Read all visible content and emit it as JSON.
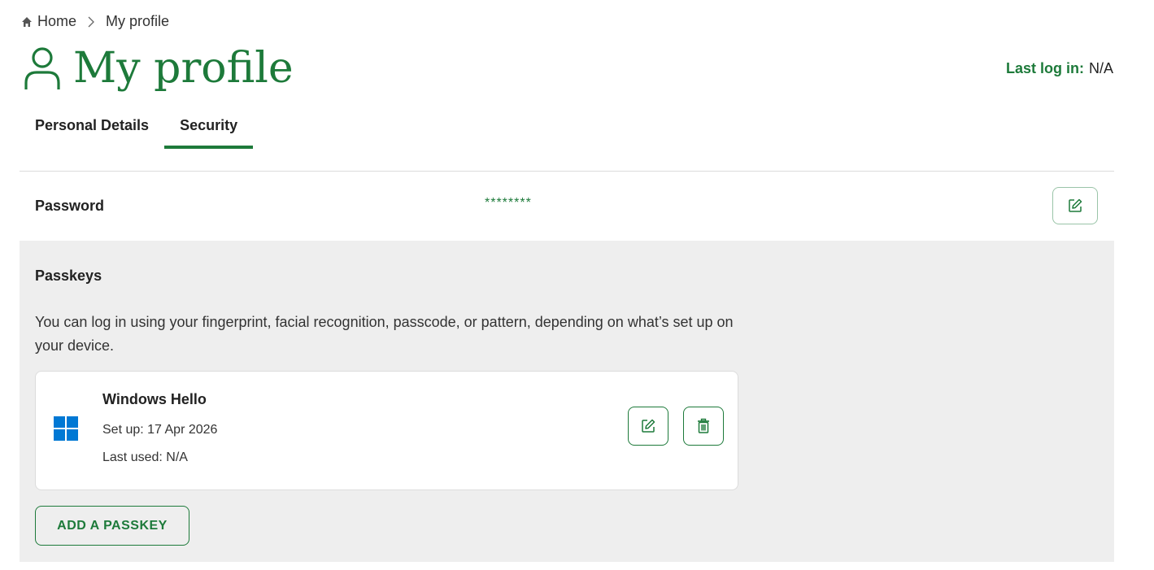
{
  "breadcrumb": {
    "home_label": "Home",
    "current_label": "My profile",
    "home_icon": "home-icon",
    "separator_icon": "chevron-right-icon"
  },
  "header": {
    "title": "My profile",
    "icon": "user-icon",
    "last_login_label": "Last log in:",
    "last_login_value": "N/A"
  },
  "tabs": [
    {
      "label": "Personal Details",
      "active": false
    },
    {
      "label": "Security",
      "active": true
    }
  ],
  "password": {
    "label": "Password",
    "value": "********",
    "edit_icon": "edit-icon"
  },
  "passkeys": {
    "title": "Passkeys",
    "description": "You can log in using your fingerprint, facial recognition, passcode, or pattern, depending on what’s set up on your device.",
    "items": [
      {
        "name": "Windows Hello",
        "icon": "windows-icon",
        "setup": "Set up: 17 Apr 2026",
        "last_used": "Last used: N/A"
      }
    ],
    "add_label": "ADD A PASSKEY"
  },
  "colors": {
    "accent": "#1d7a3a",
    "panel_bg": "#eeeeee",
    "windows_blue": "#0078d4"
  }
}
